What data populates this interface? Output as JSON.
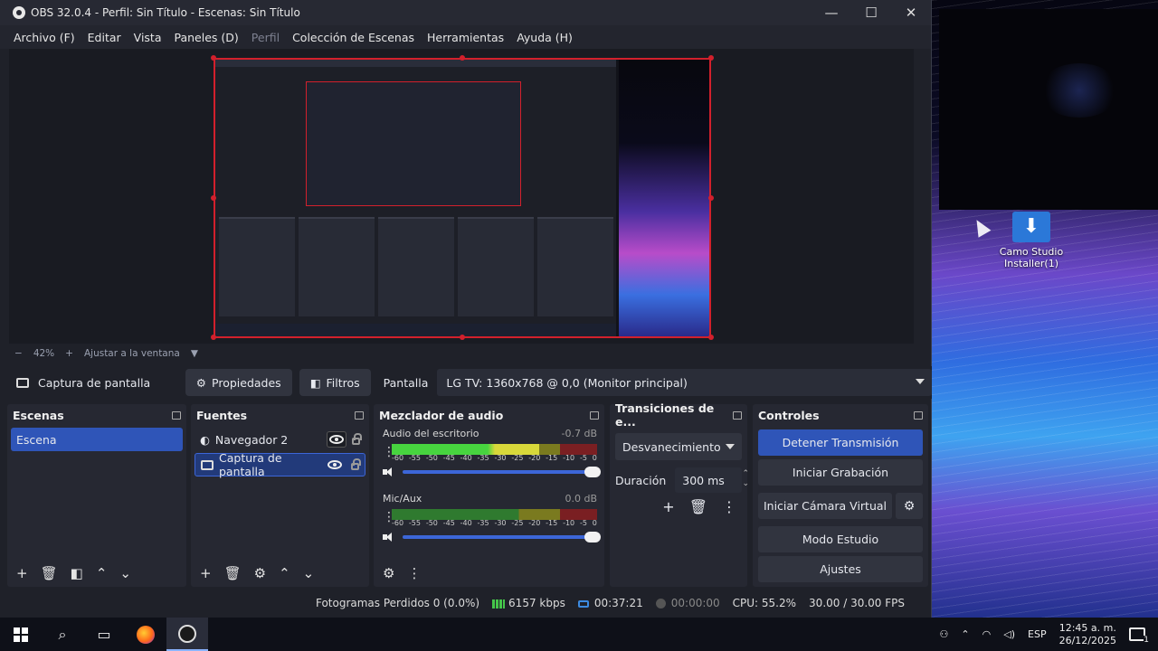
{
  "window": {
    "title": "OBS 32.0.4 - Perfil: Sin Título - Escenas: Sin Título",
    "controls": {
      "minimize": "—",
      "maximize": "☐",
      "close": "✕"
    }
  },
  "menu": [
    "Archivo (F)",
    "Editar",
    "Vista",
    "Paneles (D)",
    "Perfil",
    "Colección de Escenas",
    "Herramientas",
    "Ayuda (H)"
  ],
  "zoom": {
    "minus": "−",
    "level": "42%",
    "plus": "+",
    "fit_label": "Ajustar a la ventana"
  },
  "source_toolbar": {
    "selected_source": "Captura de pantalla",
    "properties_label": "Propiedades",
    "filters_label": "Filtros",
    "display_label": "Pantalla",
    "display_value": "LG TV: 1360x768 @ 0,0 (Monitor principal)"
  },
  "scenes": {
    "title": "Escenas",
    "items": [
      "Escena"
    ]
  },
  "sources": {
    "title": "Fuentes",
    "items": [
      {
        "name": "Navegador 2",
        "icon": "browser-icon"
      },
      {
        "name": "Captura de pantalla",
        "icon": "monitor-icon"
      }
    ]
  },
  "mixer": {
    "title": "Mezclador de audio",
    "channels": [
      {
        "name": "Audio del escritorio",
        "db": "-0.7 dB",
        "level": 0.72
      },
      {
        "name": "Mic/Aux",
        "db": "0.0 dB",
        "level": 0.0
      }
    ],
    "scale": [
      "-60",
      "-55",
      "-50",
      "-45",
      "-40",
      "-35",
      "-30",
      "-25",
      "-20",
      "-15",
      "-10",
      "-5",
      "0"
    ]
  },
  "transitions": {
    "title": "Transiciones de e...",
    "selected": "Desvanecimiento",
    "duration_label": "Duración",
    "duration_value": "300 ms"
  },
  "controls": {
    "title": "Controles",
    "stop_stream": "Detener Transmisión",
    "start_recording": "Iniciar Grabación",
    "start_virtual_cam": "Iniciar Cámara Virtual",
    "studio_mode": "Modo Estudio",
    "settings": "Ajustes"
  },
  "status": {
    "dropped_frames": "Fotogramas Perdidos 0 (0.0%)",
    "bitrate": "6157 kbps",
    "stream_time": "00:37:21",
    "rec_time": "00:00:00",
    "cpu": "CPU: 55.2%",
    "fps": "30.00 / 30.00 FPS"
  },
  "desktop": {
    "icon_label": "Camo Studio Installer(1)"
  },
  "taskbar": {
    "language": "ESP",
    "time": "12:45 a. m.",
    "date": "26/12/2025",
    "notifications": "1"
  }
}
